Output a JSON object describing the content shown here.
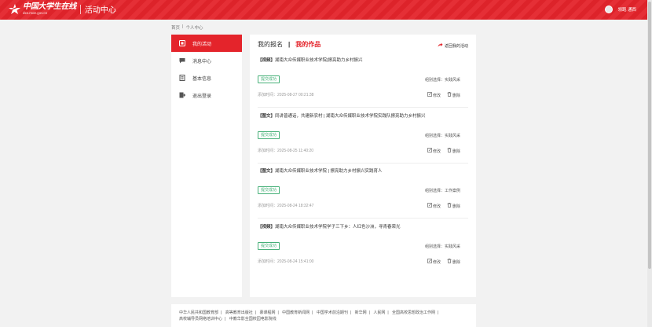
{
  "header": {
    "logo_text": "中国大学生在线",
    "logo_sub": "dxs.moe.gov.cn",
    "site_name": "活动中心",
    "user_name": "领跑 通西",
    "brand_color": "#e4242b"
  },
  "breadcrumb": [
    "首页",
    "|",
    "个人中心"
  ],
  "sidebar": {
    "items": [
      {
        "label": "我的活动",
        "icon": "flag-icon",
        "active": true
      },
      {
        "label": "消息中心",
        "icon": "chat-icon",
        "active": false
      },
      {
        "label": "基本信息",
        "icon": "list-icon",
        "active": false
      },
      {
        "label": "退出登录",
        "icon": "logout-icon",
        "active": false
      }
    ]
  },
  "main": {
    "tabs": [
      {
        "label": "我的报名",
        "active": false
      },
      {
        "label": "我的作品",
        "active": true
      }
    ],
    "tab_separator": "|",
    "return_label": "返回我的活动",
    "group_prefix": "组别选择：",
    "time_prefix": "添加时间：",
    "edit_label": "修改",
    "delete_label": "删除",
    "entries": [
      {
        "tag": "【视频】",
        "title": "湖南大众传媒职业技术学院|擦亮助力乡村振兴",
        "status": "提交成功",
        "group": "实践风采",
        "time": "2025-08-27 00:21:38"
      },
      {
        "tag": "【图文】",
        "title": "同讲普通话，共建新农村 | 湖南大众传媒职业技术学院实践队擦亮助力乡村振兴",
        "status": "提交成功",
        "group": "实践风采",
        "time": "2025-08-25 11:40:20"
      },
      {
        "tag": "【图文】",
        "title": "湖南大众传媒职业技术学院 | 擦亮助力乡村振兴实践育人",
        "status": "提交成功",
        "group": "工作案例",
        "time": "2025-08-24 18:32:47"
      },
      {
        "tag": "【视频】",
        "title": "湖南大众传媒职业技术学院学子三下乡：人红色沙洲，寻青春荣光",
        "status": "提交成功",
        "group": "实践风采",
        "time": "2025-08-24 15:41:00"
      }
    ]
  },
  "footer": {
    "line1": [
      "中华人民共和国教育部",
      "高等教育出版社",
      "慕课程网",
      "中国教育新闻网",
      "中国学术前沿期刊",
      "新华网",
      "人民网",
      "全国高校思想政治工作网"
    ],
    "line2": [
      "高校辅导员网络培训中心",
      "中教华影全国校园电影院线"
    ],
    "separator": "|"
  }
}
